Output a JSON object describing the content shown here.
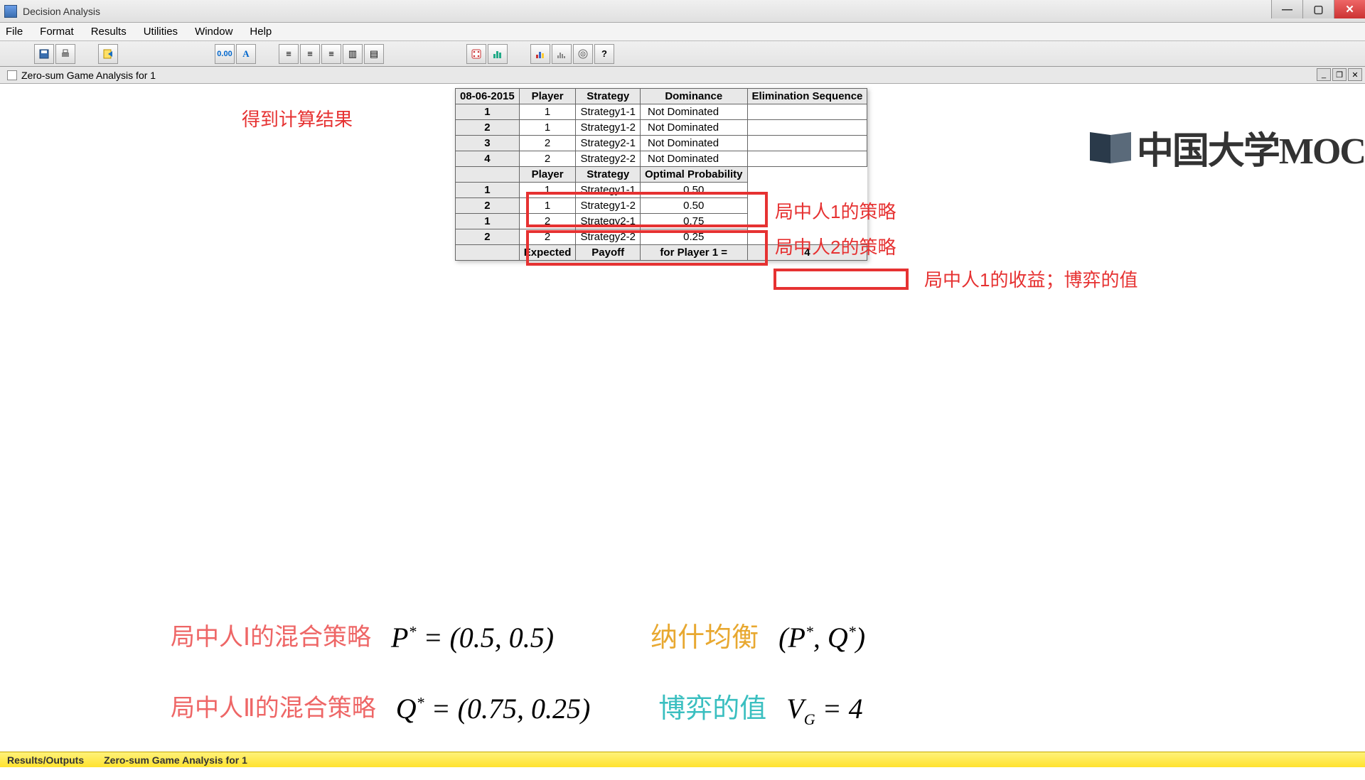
{
  "window": {
    "title": "Decision Analysis",
    "minimize": "—",
    "maximize": "▢",
    "close": "✕"
  },
  "menu": {
    "file": "File",
    "format": "Format",
    "results": "Results",
    "utilities": "Utilities",
    "window": "Window",
    "help": "Help"
  },
  "subheader": {
    "title": "Zero-sum Game Analysis for 1"
  },
  "table": {
    "date": "08-06-2015",
    "h_player": "Player",
    "h_strategy": "Strategy",
    "h_dominance": "Dominance",
    "h_elim": "Elimination Sequence",
    "h_optprob": "Optimal Probability",
    "rows_top": [
      {
        "n": "1",
        "player": "1",
        "strategy": "Strategy1-1",
        "dom": "Not Dominated"
      },
      {
        "n": "2",
        "player": "1",
        "strategy": "Strategy1-2",
        "dom": "Not Dominated"
      },
      {
        "n": "3",
        "player": "2",
        "strategy": "Strategy2-1",
        "dom": "Not Dominated"
      },
      {
        "n": "4",
        "player": "2",
        "strategy": "Strategy2-2",
        "dom": "Not Dominated"
      }
    ],
    "rows_prob": [
      {
        "n": "1",
        "player": "1",
        "strategy": "Strategy1-1",
        "prob": "0.50"
      },
      {
        "n": "2",
        "player": "1",
        "strategy": "Strategy1-2",
        "prob": "0.50"
      },
      {
        "n": "1",
        "player": "2",
        "strategy": "Strategy2-1",
        "prob": "0.75"
      },
      {
        "n": "2",
        "player": "2",
        "strategy": "Strategy2-2",
        "prob": "0.25"
      }
    ],
    "expected": "Expected",
    "payoff": "Payoff",
    "forplayer": "for Player 1 =",
    "payoff_value": "4"
  },
  "annotations": {
    "result_title": "得到计算结果",
    "p1_strategy": "局中人1的策略",
    "p2_strategy": "局中人2的策略",
    "p1_payoff": "局中人1的收益；博弈的值"
  },
  "formulas": {
    "p1_label": "局中人Ⅰ的混合策略",
    "p1_math": "P* = (0.5, 0.5)",
    "p2_label": "局中人Ⅱ的混合策略",
    "p2_math": "Q* = (0.75, 0.25)",
    "nash_label": "纳什均衡",
    "nash_math": "(P*, Q*)",
    "value_label": "博弈的值",
    "value_math": "V_G = 4"
  },
  "status": {
    "left": "Results/Outputs",
    "right": "Zero-sum Game Analysis for 1"
  },
  "watermark": "中国大学MOC",
  "chart_data": {
    "type": "table",
    "description": "Zero-sum game solver output: dominance check and mixed-strategy probabilities",
    "dominance": [
      {
        "row": 1,
        "player": 1,
        "strategy": "Strategy1-1",
        "dominance": "Not Dominated"
      },
      {
        "row": 2,
        "player": 1,
        "strategy": "Strategy1-2",
        "dominance": "Not Dominated"
      },
      {
        "row": 3,
        "player": 2,
        "strategy": "Strategy2-1",
        "dominance": "Not Dominated"
      },
      {
        "row": 4,
        "player": 2,
        "strategy": "Strategy2-2",
        "dominance": "Not Dominated"
      }
    ],
    "optimal_probabilities": [
      {
        "player": 1,
        "strategy": "Strategy1-1",
        "probability": 0.5
      },
      {
        "player": 1,
        "strategy": "Strategy1-2",
        "probability": 0.5
      },
      {
        "player": 2,
        "strategy": "Strategy2-1",
        "probability": 0.75
      },
      {
        "player": 2,
        "strategy": "Strategy2-2",
        "probability": 0.25
      }
    ],
    "expected_payoff_player1": 4,
    "mixed_strategy_player1": [
      0.5,
      0.5
    ],
    "mixed_strategy_player2": [
      0.75,
      0.25
    ],
    "game_value": 4
  }
}
